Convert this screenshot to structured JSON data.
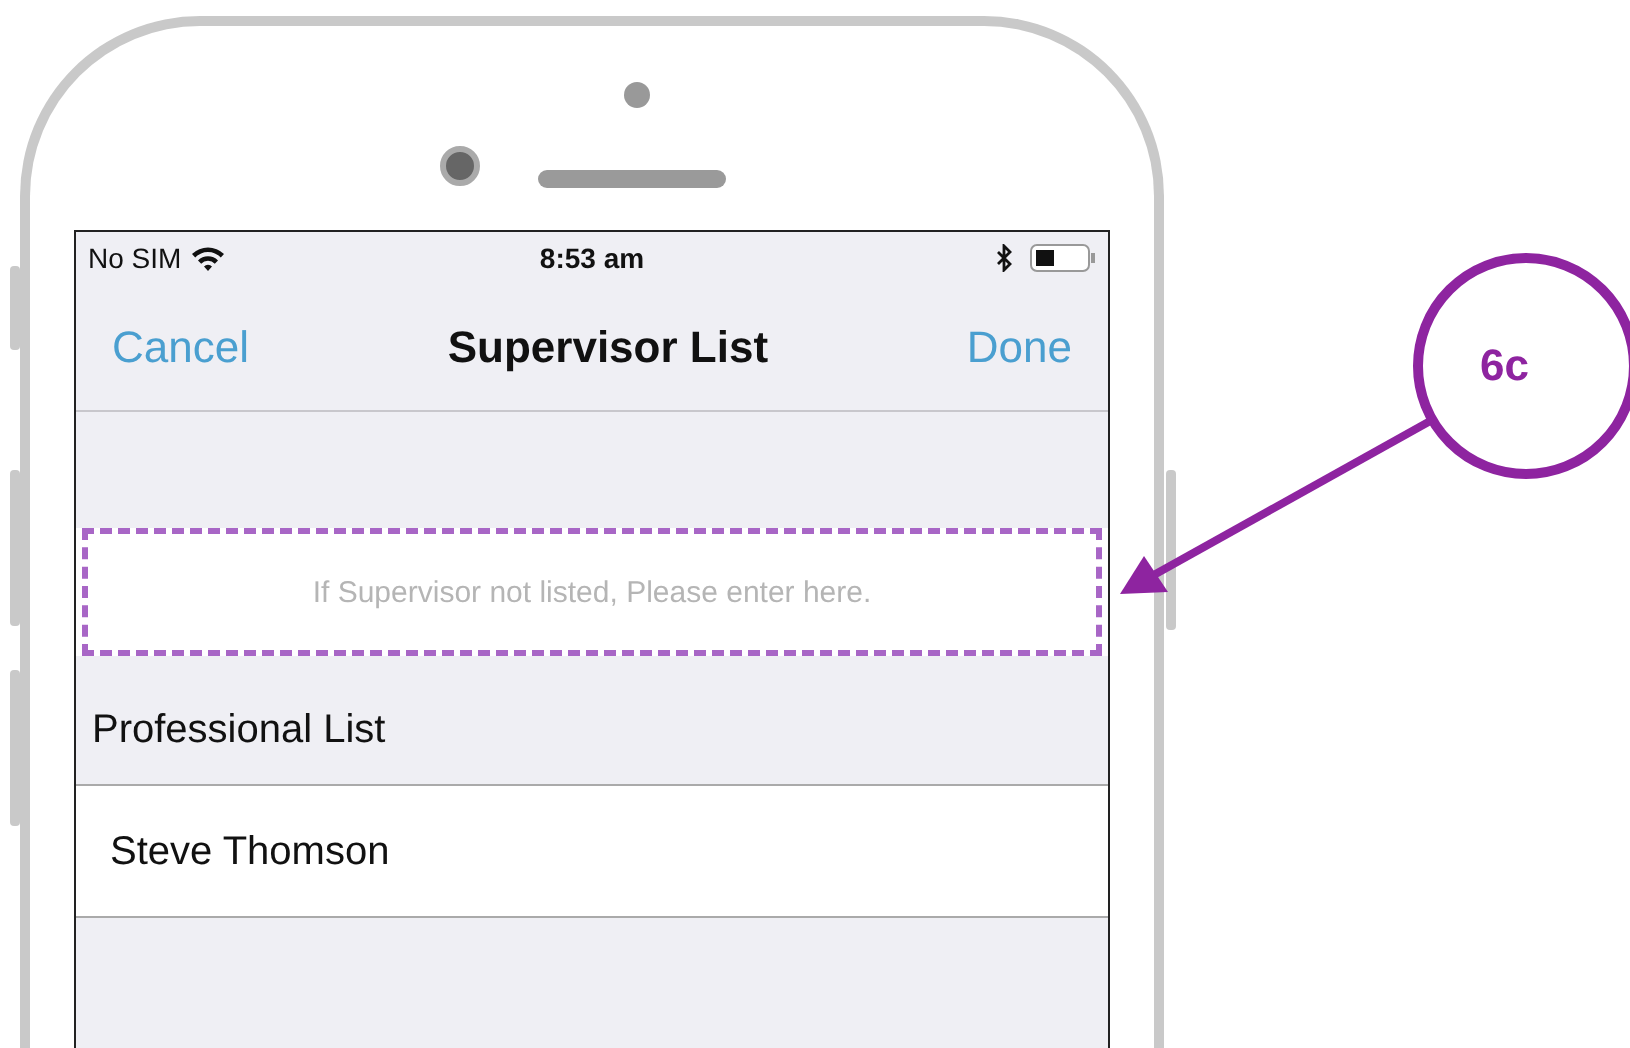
{
  "status_bar": {
    "carrier": "No SIM",
    "time": "8:53 am"
  },
  "nav_bar": {
    "left_button": "Cancel",
    "title": "Supervisor List",
    "right_button": "Done"
  },
  "entry_field": {
    "placeholder": "If Supervisor not listed, Please enter here.",
    "highlighted": true
  },
  "section": {
    "header": "Professional List",
    "rows": [
      {
        "name": "Steve Thomson"
      }
    ]
  },
  "callout": {
    "label": "6c"
  }
}
